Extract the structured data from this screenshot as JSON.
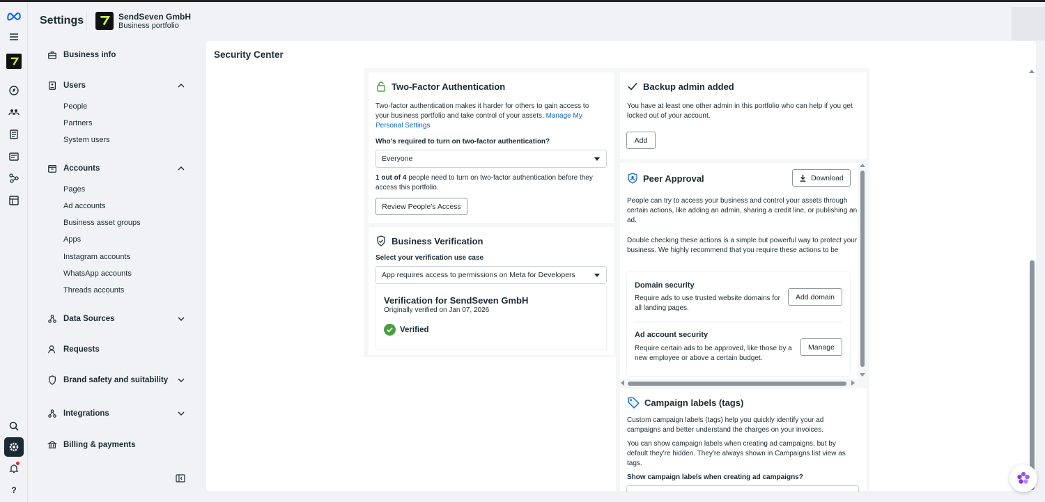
{
  "header": {
    "title": "Settings",
    "business_name": "SendSeven GmbH",
    "business_subtitle": "Business portfolio"
  },
  "rail": {
    "items": [
      "meta-logo",
      "menu-icon",
      "business-logo",
      "compass-icon",
      "people-icon",
      "pages-icon",
      "campaign-icon",
      "graph-icon",
      "catalog-icon",
      "search-icon",
      "settings-icon",
      "bell-icon",
      "help-icon"
    ]
  },
  "sidebar": {
    "business_info": "Business info",
    "users": "Users",
    "users_items": [
      "People",
      "Partners",
      "System users"
    ],
    "accounts": "Accounts",
    "accounts_items": [
      "Pages",
      "Ad accounts",
      "Business asset groups",
      "Apps",
      "Instagram accounts",
      "WhatsApp accounts",
      "Threads accounts"
    ],
    "data_sources": "Data Sources",
    "requests": "Requests",
    "brand_safety": "Brand safety and suitability",
    "integrations": "Integrations",
    "billing": "Billing & payments"
  },
  "main": {
    "title": "Security Center"
  },
  "two_factor": {
    "title": "Two-Factor Authentication",
    "desc": "Two-factor authentication makes it harder for others to gain access to your business portfolio and take control of your assets.",
    "link": "Manage My Personal Settings",
    "question": "Who's required to turn on two-factor authentication?",
    "selected": "Everyone",
    "count_bold": "1 out of 4",
    "count_rest": "people need to turn on two-factor authentication before they access this portfolio.",
    "button": "Review People's Access"
  },
  "verification": {
    "title": "Business Verification",
    "label": "Select your verification use case",
    "selected": "App requires access to permissions on Meta for Developers",
    "heading": "Verification for SendSeven GmbH",
    "verified_on": "Originally verified on Jan 07, 2026",
    "status": "Verified"
  },
  "backup_admin": {
    "title": "Backup admin added",
    "desc": "You have at least one other admin in this portfolio who can help if you get locked out of your account.",
    "button": "Add"
  },
  "peer_approval": {
    "title": "Peer Approval",
    "download": "Download",
    "desc1": "People can try to access your business and control your assets through certain actions, like adding an admin, sharing a credit line, or publishing an ad.",
    "desc2": "Double checking these actions is a simple but powerful way to protect your business. We highly recommend that you require these actions to be",
    "domain_title": "Domain security",
    "domain_desc": "Require ads to use trusted website domains for all landing pages.",
    "domain_button": "Add domain",
    "ad_title": "Ad account security",
    "ad_desc": "Require certain ads to be approved, like those by a new employee or above a certain budget.",
    "ad_button": "Manage"
  },
  "campaign_labels": {
    "title": "Campaign labels (tags)",
    "desc1": "Custom campaign labels (tags) help you quickly identify your ad campaigns and better understand the charges on your invoices.",
    "desc2": "You can show campaign labels when creating ad campaigns, but by default they're hidden. They're always shown in Campaigns list view as tags.",
    "question": "Show campaign labels when creating ad campaigns?"
  },
  "colors": {
    "accent": "#0a66c2",
    "verified": "#4a9e3f",
    "sidebar_bg": "#f0f2f5",
    "text": "#1c2b33"
  }
}
